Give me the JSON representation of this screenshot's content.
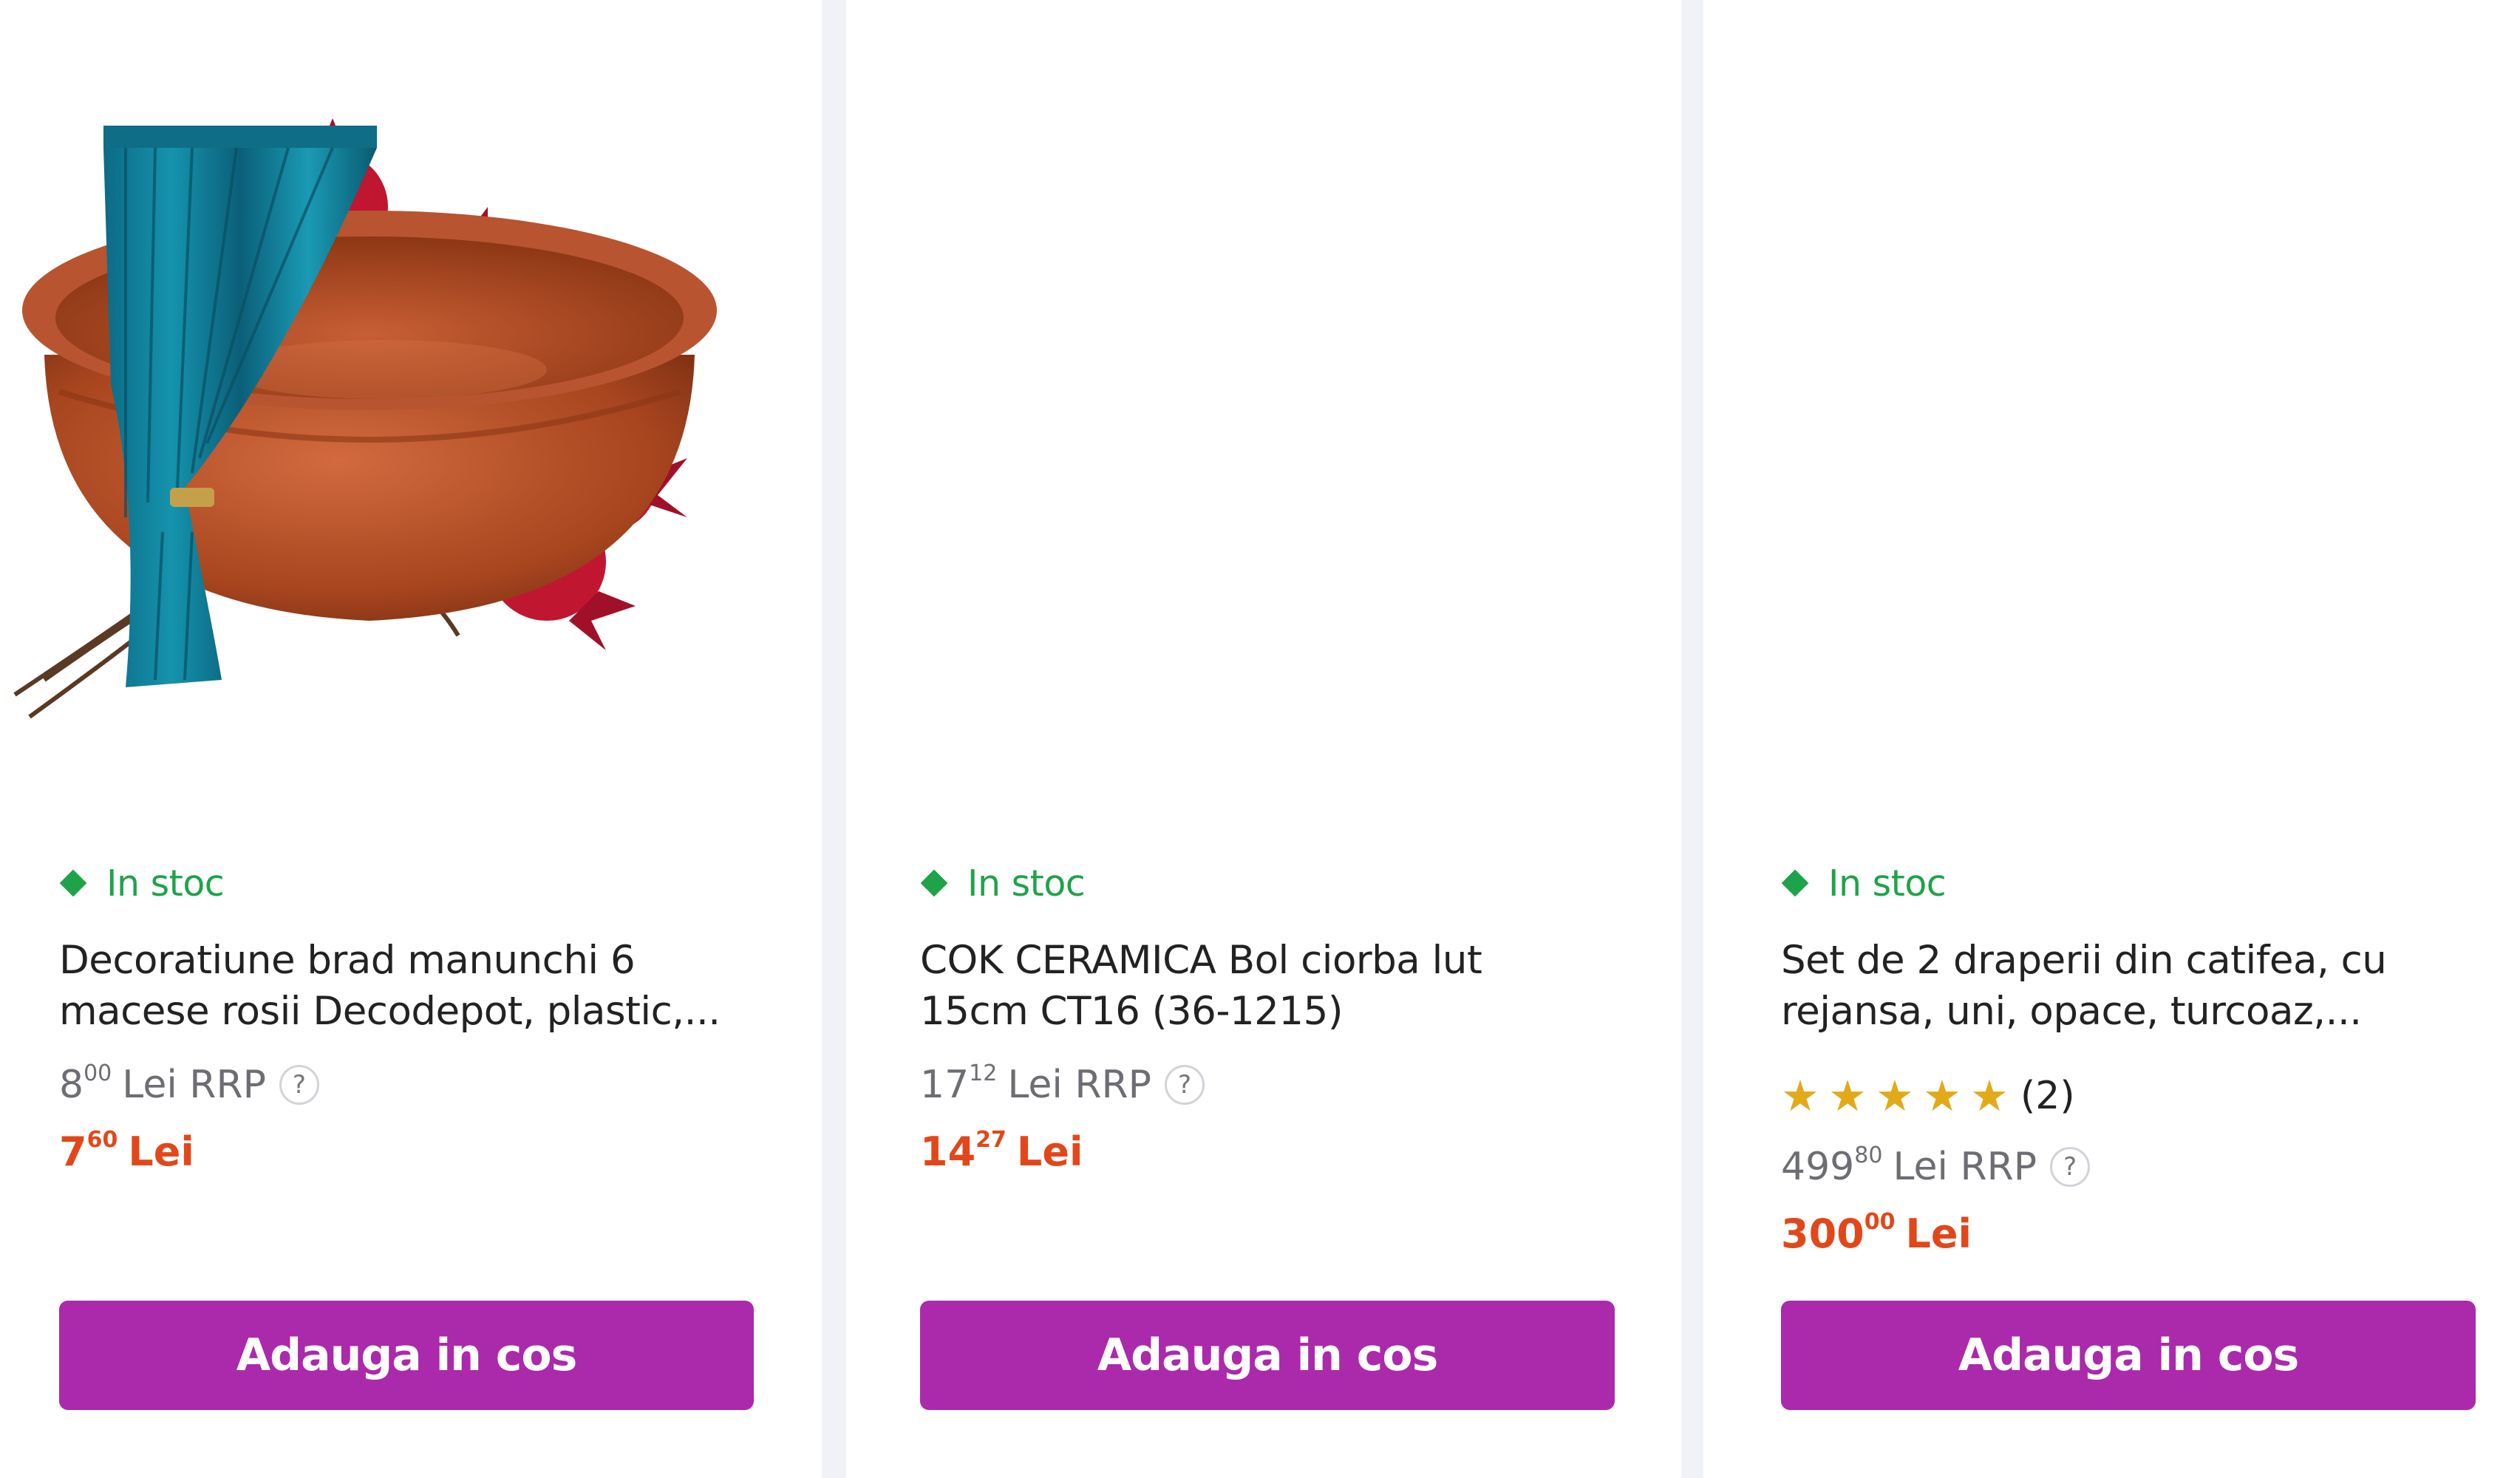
{
  "products": [
    {
      "image": "pomegranate-branch-decoration",
      "stock": "In stoc",
      "title_line1": "Decoratiune brad manunchi 6",
      "title_line2": "macese rosii Decodepot, plastic,...",
      "rrp_int": "8",
      "rrp_dec": "00",
      "rrp_suffix": "Lei RRP",
      "help": "?",
      "price_int": "7",
      "price_dec": "60",
      "price_suffix": "Lei",
      "button": "Adauga in cos"
    },
    {
      "image": "clay-bowl",
      "stock": "In stoc",
      "title_line1": "COK CERAMICA Bol ciorba lut",
      "title_line2": "15cm CT16 (36-1215)",
      "rrp_int": "17",
      "rrp_dec": "12",
      "rrp_suffix": "Lei RRP",
      "help": "?",
      "price_int": "14",
      "price_dec": "27",
      "price_suffix": "Lei",
      "button": "Adauga in cos"
    },
    {
      "image": "teal-velvet-curtain",
      "stock": "In stoc",
      "title_line1": "Set de 2 draperii din catifea, cu",
      "title_line2": "rejansa, uni, opace, turcoaz,...",
      "rating_stars": 5,
      "rating_count": "(2)",
      "rrp_int": "499",
      "rrp_dec": "80",
      "rrp_suffix": "Lei RRP",
      "help": "?",
      "price_int": "300",
      "price_dec": "00",
      "price_suffix": "Lei",
      "button": "Adauga in cos"
    }
  ],
  "colors": {
    "stock_green": "#1ea34a",
    "price_orange": "#e2471a",
    "button_purple": "#ab29ab",
    "star_gold": "#e2aa19"
  }
}
